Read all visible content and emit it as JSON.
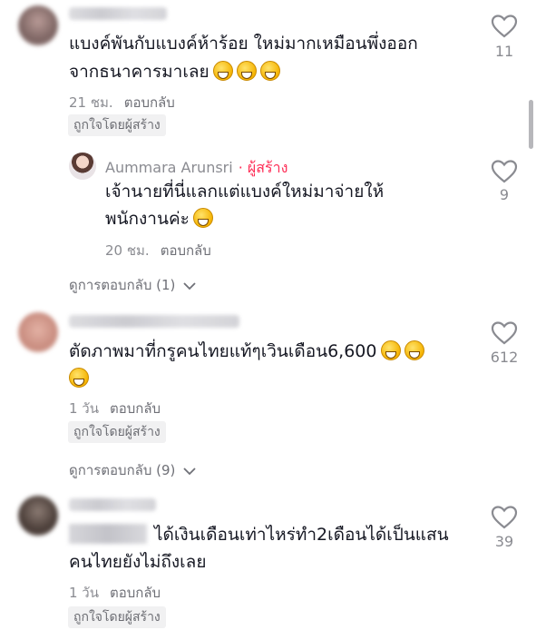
{
  "comments": [
    {
      "text_line1": "แบงค์พันกับแบงค์ห้าร้อย ใหม่มากเหมือนพึ่งออก",
      "text_line2": "จากธนาคารมาเลย",
      "emoji": "grinning-face-emoji",
      "time": "21 ชม.",
      "reply": "ตอบกลับ",
      "liked_by_creator": "ถูกใจโดยผู้สร้าง",
      "likes": "11",
      "view_replies": "ดูการตอบกลับ (1)",
      "replies": [
        {
          "author": "Aummara Arunsri",
          "creator_label": "· ผู้สร้าง",
          "text_line1": "เจ้านายที่นี่แลกแต่แบงค์ใหม่มาจ่ายให้",
          "text_line2": "พนักงานค่ะ",
          "emoji": "smiling-face-emoji",
          "time": "20 ชม.",
          "reply": "ตอบกลับ",
          "likes": "9"
        }
      ]
    },
    {
      "text_line1": "ตัดภาพมาที่กรูคนไทยแท้ๆเวินเดือน6,600",
      "emoji": "grinning-sweat-emoji",
      "time": "1 วัน",
      "reply": "ตอบกลับ",
      "liked_by_creator": "ถูกใจโดยผู้สร้าง",
      "likes": "612",
      "view_replies": "ดูการตอบกลับ (9)"
    },
    {
      "text_line1": "ได้เงินเดือนเท่าไหร่ทำ2เดือนได้เป็นแสน",
      "text_line2": "คนไทยยังไม่ถึงเลย",
      "time": "1 วัน",
      "reply": "ตอบกลับ",
      "liked_by_creator": "ถูกใจโดยผู้สร้าง",
      "likes": "39"
    }
  ],
  "colors": {
    "text": "#161823",
    "meta": "#8a8b91",
    "creator_accent": "#fe2c55",
    "badge_bg": "#f1f1f2"
  },
  "icons": {
    "like": "heart-outline-icon",
    "expand": "chevron-down-icon"
  }
}
